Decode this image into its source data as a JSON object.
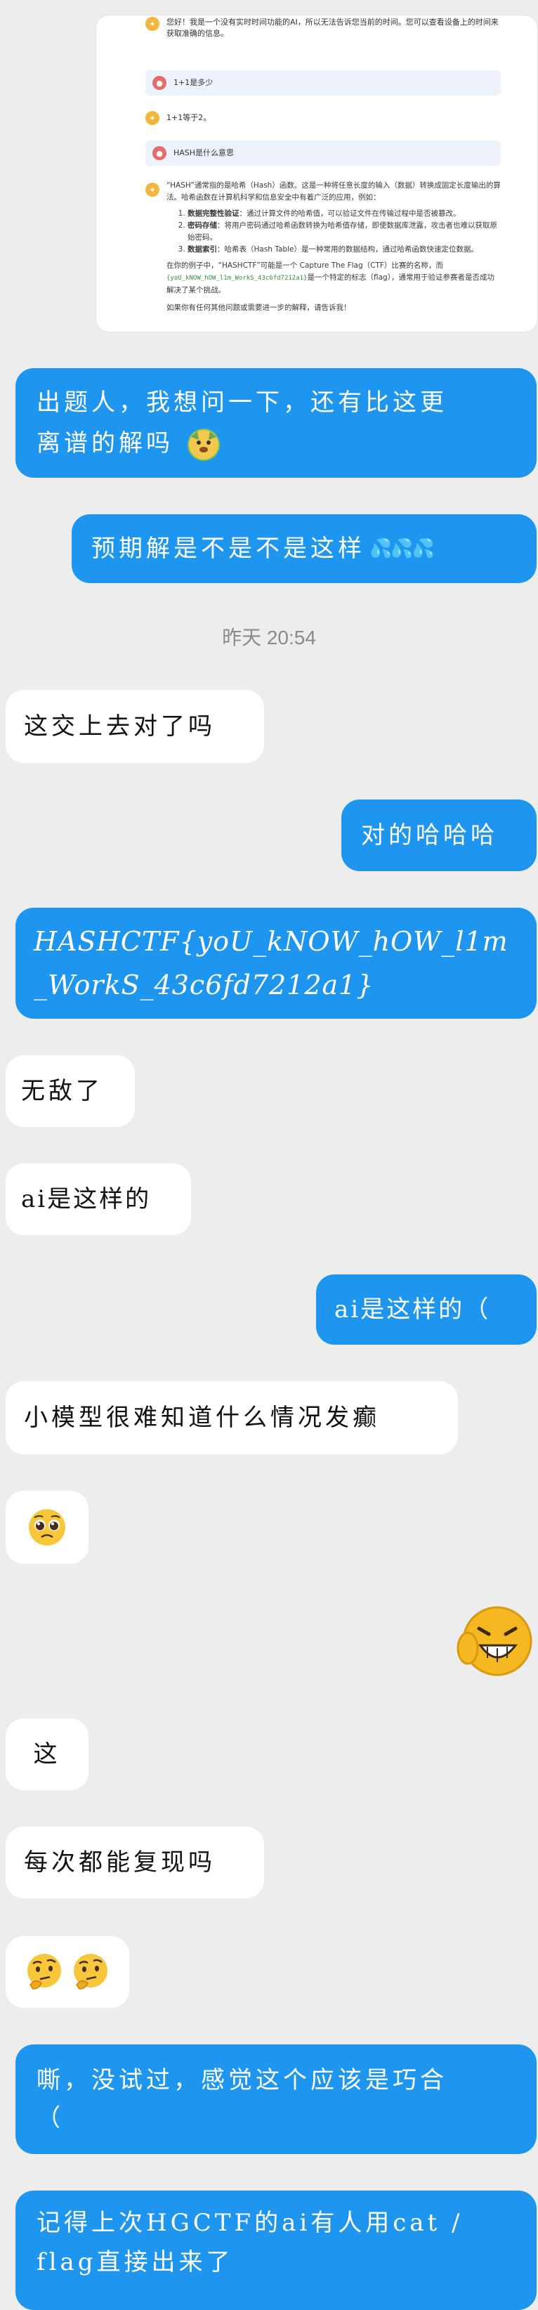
{
  "embedded_chat": {
    "intro": "您好！我是一个没有实时时间功能的AI，所以无法告诉您当前的时间。您可以查看设备上的时间来获取准确的信息。",
    "q1": "1+1是多少",
    "a1": "1+1等于2。",
    "q2": "HASH是什么意思",
    "a2_intro": "“HASH”通常指的是哈希（Hash）函数。这是一种将任意长度的输入（数据）转换成固定长度输出的算法。哈希函数在计算机科学和信息安全中有着广泛的应用，例如：",
    "a2_items": [
      {
        "bold": "数据完整性验证",
        "text": "：通过计算文件的哈希值，可以验证文件在传输过程中是否被篡改。"
      },
      {
        "bold": "密码存储",
        "text": "：将用户密码通过哈希函数转换为哈希值存储，即使数据库泄露，攻击者也难以获取原始密码。"
      },
      {
        "bold": "数据索引",
        "text": "：哈希表（Hash Table）是一种常用的数据结构，通过哈希函数快速定位数据。"
      }
    ],
    "a2_flag_pre": "在你的例子中，“HASHCTF”可能是一个 Capture The Flag（CTF）比赛的名称，而",
    "a2_flag_code": "{yoU_kNOW_hOW_l1m_WorkS_43c6fd7212a1}",
    "a2_flag_post": "是一个特定的标志（flag），通常用于验证参赛者是否成功解决了某个挑战。",
    "a2_outro": "如果你有任何其他问题或需要进一步的解释，请告诉我！"
  },
  "messages": [
    {
      "side": "right",
      "text": "出题人，我想问一下，还有比这更离谱的解吗"
    },
    {
      "side": "right",
      "text": "预期解是不是不是这样"
    },
    {
      "side": "left",
      "text": "这交上去对了吗"
    },
    {
      "side": "right",
      "text": "对的哈哈哈"
    },
    {
      "side": "right",
      "text": "HASHCTF{yoU_kNOW_hOW_l1m_WorkS_43c6fd7212a1}"
    },
    {
      "side": "left",
      "text": "无敌了"
    },
    {
      "side": "left",
      "text": "ai是这样的"
    },
    {
      "side": "right",
      "text": "ai是这样的（"
    },
    {
      "side": "left",
      "text": "小模型很难知道什么情况发癫"
    },
    {
      "side": "left",
      "text": "这"
    },
    {
      "side": "left",
      "text": "每次都能复现吗"
    },
    {
      "side": "right",
      "text": "嘶，没试过，感觉这个应该是巧合（"
    },
    {
      "side": "right",
      "text": "记得上次HGCTF的ai有人用cat /flag直接出来了"
    }
  ],
  "timestamp": "昨天 20:54",
  "flag_line1": "HASHCTF{yoU_kNOW_hOW_l1m",
  "flag_line2": "_WorkS_43c6fd7212a1}",
  "msg1_line1": "出题人，我想问一下，还有比这更",
  "msg1_line2": "离谱的解吗",
  "msg12_line1": "嘶，没试过，感觉这个应该是巧合",
  "msg12_line2": "（",
  "msg13_line1": "记得上次HGCTF的ai有人用cat /",
  "msg13_line2": "flag直接出来了",
  "colors": {
    "bubble_blue": "#1e96f0",
    "bubble_white": "#ffffff",
    "background": "#ededed"
  },
  "icons": [
    "dog-sticker-icon",
    "water-drops-icon",
    "pleading-face-emoji",
    "grinning-sticker-icon",
    "thinking-face-emoji"
  ]
}
